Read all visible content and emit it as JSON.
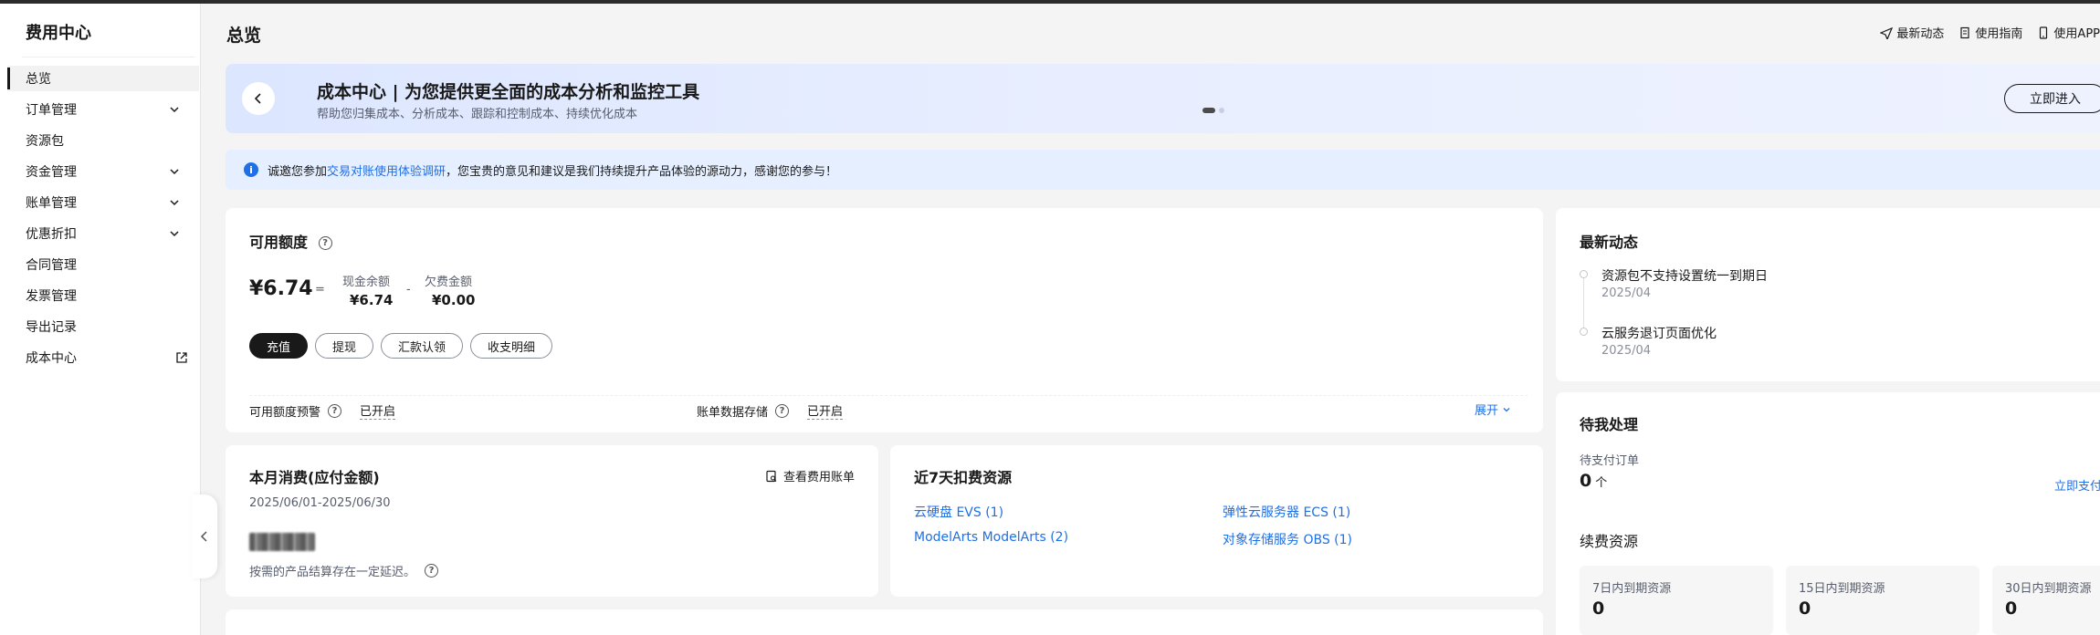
{
  "sidebar": {
    "title": "费用中心",
    "items": [
      {
        "label": "总览",
        "active": true,
        "expandable": false
      },
      {
        "label": "订单管理",
        "expandable": true
      },
      {
        "label": "资源包",
        "expandable": false
      },
      {
        "label": "资金管理",
        "expandable": true
      },
      {
        "label": "账单管理",
        "expandable": true
      },
      {
        "label": "优惠折扣",
        "expandable": true
      },
      {
        "label": "合同管理",
        "expandable": false
      },
      {
        "label": "发票管理",
        "expandable": false
      },
      {
        "label": "导出记录",
        "expandable": false
      },
      {
        "label": "成本中心",
        "expandable": false,
        "external": true
      }
    ]
  },
  "header": {
    "title": "总览",
    "links": [
      {
        "label": "最新动态",
        "icon": "send-icon"
      },
      {
        "label": "使用指南",
        "icon": "document-icon"
      },
      {
        "label": "使用APP",
        "icon": "phone-icon"
      }
    ]
  },
  "banner": {
    "title": "成本中心 | 为您提供更全面的成本分析和监控工具",
    "subtitle": "帮助您归集成本、分析成本、跟踪和控制成本、持续优化成本",
    "cta": "立即进入"
  },
  "notice": {
    "prefix": "诚邀您参加",
    "link": "交易对账使用体验调研",
    "suffix": "，您宝贵的意见和建议是我们持续提升产品体验的源动力，感谢您的参与！"
  },
  "credit": {
    "title": "可用额度",
    "total": "¥6.74",
    "eq": "=",
    "minus": "-",
    "cash_label": "现金余额",
    "cash_value": "¥6.74",
    "debt_label": "欠费金额",
    "debt_value": "¥0.00",
    "buttons": [
      "充值",
      "提现",
      "汇款认领",
      "收支明细"
    ],
    "alert_label": "可用额度预警",
    "alert_status": "已开启",
    "storage_label": "账单数据存储",
    "storage_status": "已开启",
    "expand": "展开"
  },
  "monthly": {
    "title": "本月消费(应付金额)",
    "view_bill": "查看费用账单",
    "period": "2025/06/01-2025/06/30",
    "note": "按需的产品结算存在一定延迟。"
  },
  "deduct": {
    "title": "近7天扣费资源",
    "items": [
      "云硬盘 EVS (1)",
      "弹性云服务器 ECS (1)",
      "ModelArts ModelArts (2)",
      "对象存储服务 OBS (1)"
    ]
  },
  "news": {
    "title": "最新动态",
    "items": [
      {
        "title": "资源包不支持设置统一到期日",
        "date": "2025/04"
      },
      {
        "title": "云服务退订页面优化",
        "date": "2025/04"
      }
    ]
  },
  "todo": {
    "title": "待我处理",
    "pending_label": "待支付订单",
    "pending_count": "0",
    "pending_unit": "个",
    "pay_link": "立即支付",
    "renew_title": "续费资源",
    "boxes": [
      {
        "label": "7日内到期资源",
        "value": "0"
      },
      {
        "label": "15日内到期资源",
        "value": "0"
      },
      {
        "label": "30日内到期资源",
        "value": "0"
      }
    ]
  },
  "colors": {
    "accent": "#1f6fe5",
    "primary": "#191919",
    "background": "#f4f4f4"
  }
}
